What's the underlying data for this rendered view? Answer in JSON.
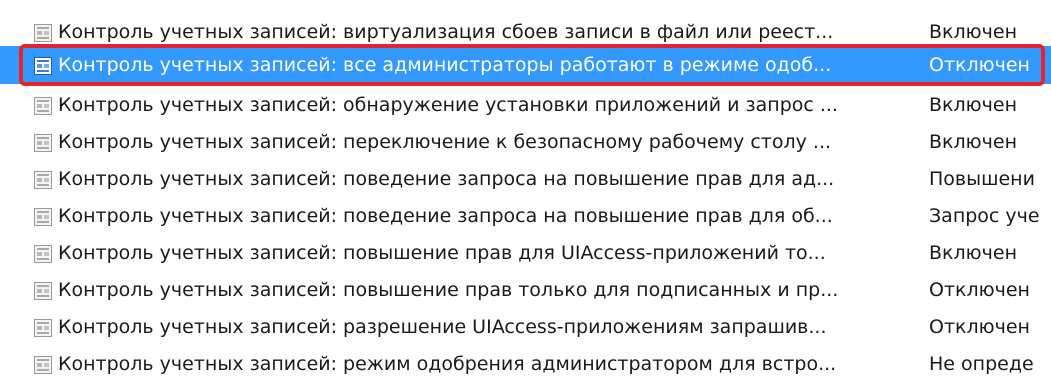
{
  "policies": {
    "accent_color": "#3399ff",
    "annotation_color": "#e3242b",
    "selected_row": 1,
    "icon": "policy-setting-icon",
    "rows": [
      {
        "policy": "Контроль учетных записей: виртуализация сбоев записи в файл или реест...",
        "setting": "Включен"
      },
      {
        "policy": "Контроль учетных записей: все администраторы работают в режиме одоб...",
        "setting": "Отключен"
      },
      {
        "policy": "Контроль учетных записей: обнаружение установки приложений и запрос ...",
        "setting": "Включен"
      },
      {
        "policy": "Контроль учетных записей: переключение к безопасному рабочему столу ...",
        "setting": "Включен"
      },
      {
        "policy": "Контроль учетных записей: поведение запроса на повышение прав для ад...",
        "setting": "Повышени"
      },
      {
        "policy": "Контроль учетных записей: поведение запроса на повышение прав для об...",
        "setting": "Запрос уче"
      },
      {
        "policy": "Контроль учетных записей: повышение прав для UIAccess-приложений то...",
        "setting": "Включен"
      },
      {
        "policy": "Контроль учетных записей: повышение прав только для подписанных и пр...",
        "setting": "Отключен"
      },
      {
        "policy": "Контроль учетных записей: разрешение UIAccess-приложениям запрашив...",
        "setting": "Отключен"
      },
      {
        "policy": "Контроль учетных записей: режим одобрения администратором для встро...",
        "setting": "Не опреде"
      }
    ]
  }
}
